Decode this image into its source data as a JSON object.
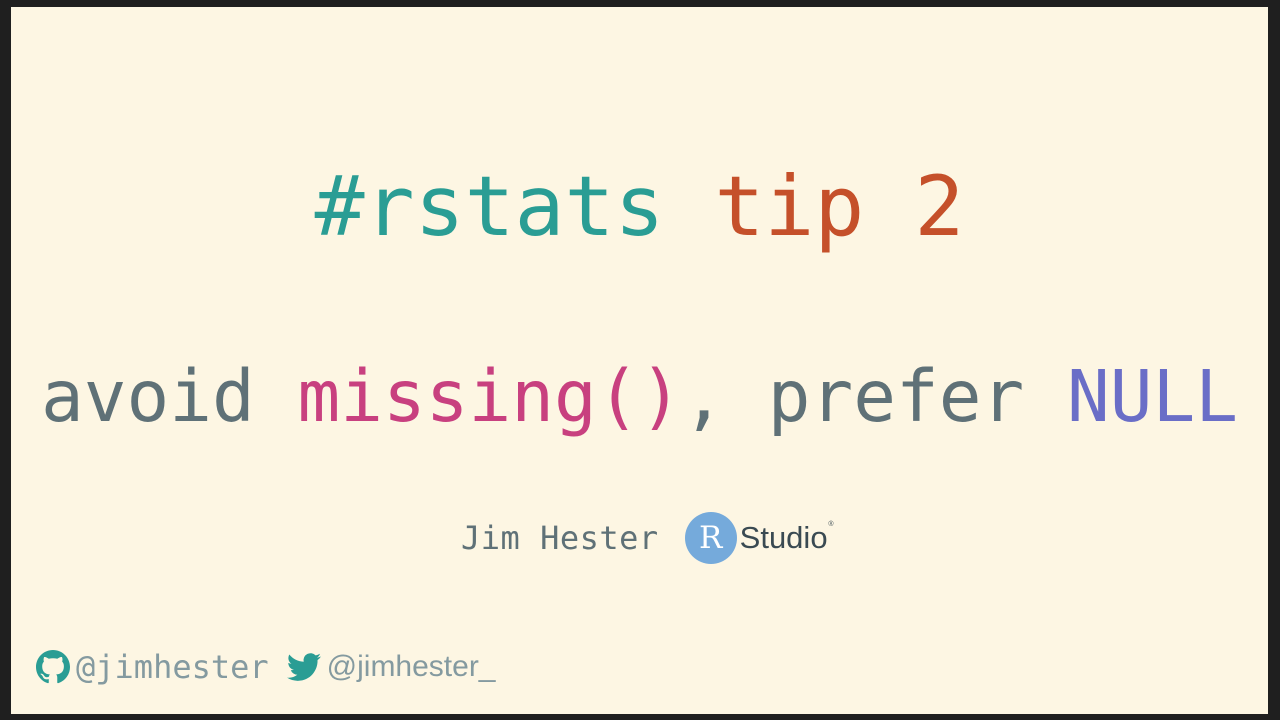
{
  "slide": {
    "title": {
      "part1": "#rstats",
      "part2": "tip 2"
    },
    "subtitle": {
      "part1": "avoid ",
      "part2": "missing()",
      "part3": ", prefer ",
      "part4": "NULL"
    },
    "author": "Jim Hester",
    "logo": {
      "r_letter": "R",
      "studio_text": "Studio",
      "registered": "®"
    },
    "social": {
      "github_handle": "@jimhester",
      "twitter_handle": "@jimhester_"
    }
  },
  "colors": {
    "background": "#fdf6e3",
    "frame": "#1f1f1f",
    "teal": "#2a9d94",
    "orange": "#c5502a",
    "gray": "#5f7177",
    "magenta": "#c8407f",
    "blue": "#6a6ec7",
    "muted": "#849aa0",
    "rstudio_blue": "#75aadb"
  },
  "icons": {
    "github": "github-icon",
    "twitter": "twitter-icon"
  }
}
